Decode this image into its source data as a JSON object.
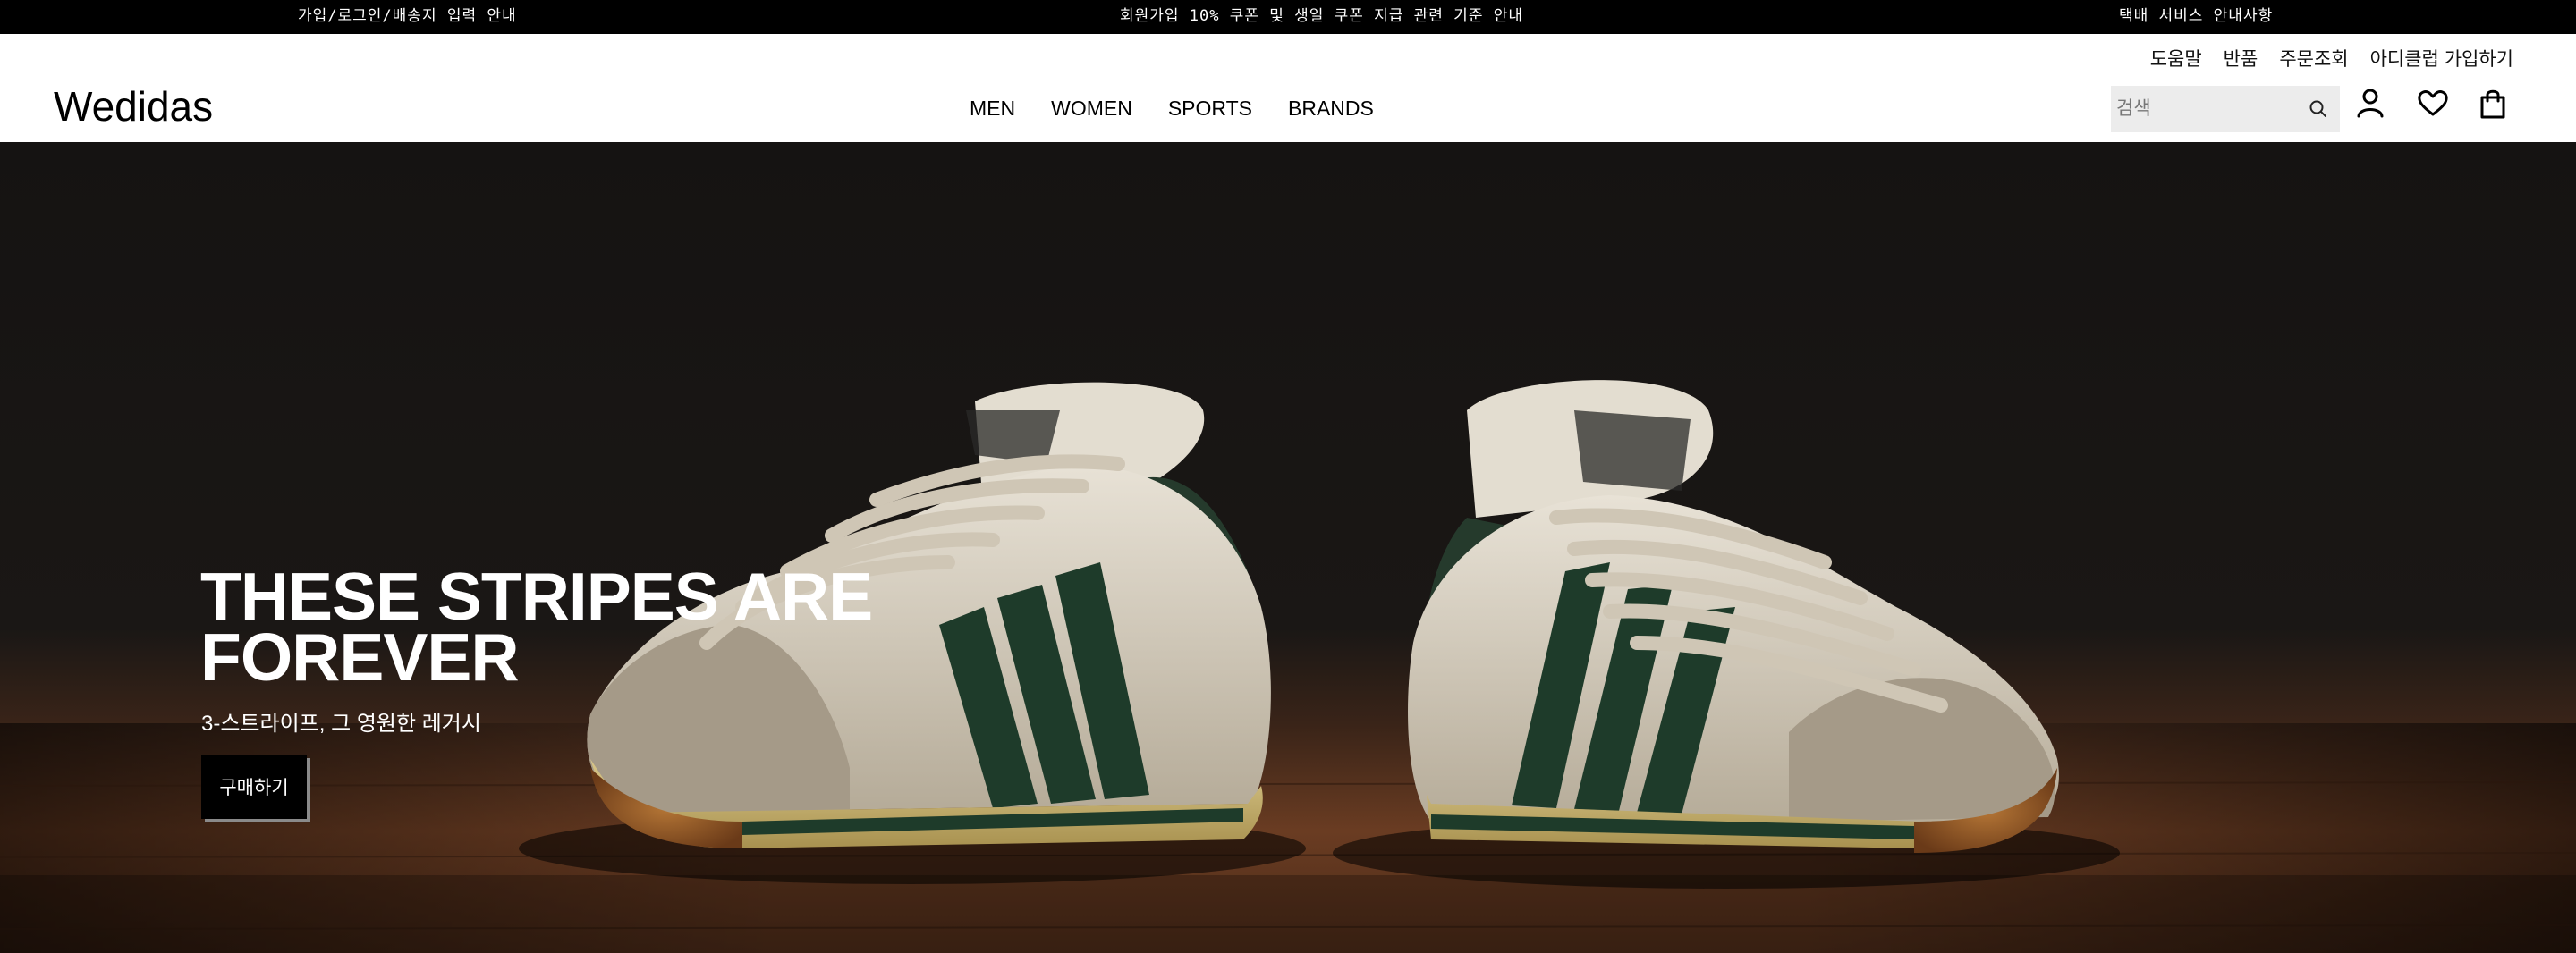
{
  "announcements": {
    "left": "가입/로그인/배송지 입력 안내",
    "center": "회원가입 10% 쿠폰 및 생일 쿠폰 지급 관련 기준 안내",
    "right": "택배 서비스 안내사항"
  },
  "utility_nav": [
    "도움말",
    "반품",
    "주문조회",
    "아디클럽 가입하기"
  ],
  "logo": "Wedidas",
  "main_nav": [
    "MEN",
    "WOMEN",
    "SPORTS",
    "BRANDS"
  ],
  "search": {
    "placeholder": "검색"
  },
  "icons": {
    "search": "search-icon",
    "account": "user-icon",
    "wishlist": "heart-icon",
    "cart": "shopping-bag-icon"
  },
  "hero": {
    "title_line1": "THESE STRIPES ARE",
    "title_line2": "FOREVER",
    "subtitle": "3-스트라이프, 그 영원한 레거시",
    "cta": "구매하기",
    "image": "vintage white sneakers with three dark green stripes on wooden floor"
  },
  "colors": {
    "top_bar": "#000000",
    "header_bg": "#ffffff",
    "search_bg": "#ececec",
    "hero_bg": "#161413",
    "cta_bg": "#000000"
  }
}
